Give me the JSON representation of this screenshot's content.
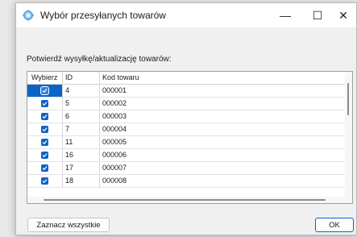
{
  "window": {
    "title": "Wybór przesyłanych towarów",
    "minimize_glyph": "—",
    "maximize_glyph": "☐",
    "close_glyph": "✕"
  },
  "prompt": "Potwierdź wysyłkę/aktualizację towarów:",
  "grid": {
    "columns": [
      "Wybierz",
      "ID",
      "Kod towaru"
    ],
    "rows": [
      {
        "checked": true,
        "id": "4",
        "code": "000001",
        "selected": true
      },
      {
        "checked": true,
        "id": "5",
        "code": "000002"
      },
      {
        "checked": true,
        "id": "6",
        "code": "000003"
      },
      {
        "checked": true,
        "id": "7",
        "code": "000004"
      },
      {
        "checked": true,
        "id": "11",
        "code": "000005"
      },
      {
        "checked": true,
        "id": "16",
        "code": "000006"
      },
      {
        "checked": true,
        "id": "17",
        "code": "000007"
      },
      {
        "checked": true,
        "id": "18",
        "code": "000008"
      }
    ]
  },
  "buttons": {
    "select_all": "Zaznacz wszystkie",
    "ok": "OK"
  },
  "colors": {
    "accent": "#0a63c7",
    "checkbox": "#0e63c8",
    "window_bg": "#f0f0f0"
  },
  "icons": {
    "app": "gear-cog-icon",
    "checkbox": "checkmark-icon"
  }
}
